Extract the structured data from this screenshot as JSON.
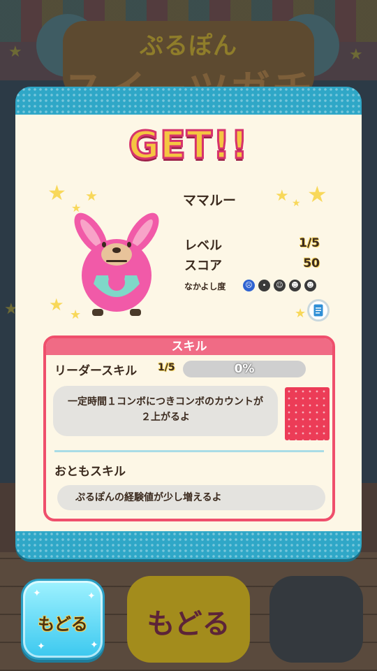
{
  "background": {
    "title_small": "ぷるぽん",
    "title_big": "スイーツガチャ",
    "back_button_label": "もどる"
  },
  "dialog": {
    "title": "GET!!",
    "character": {
      "name": "ママルー",
      "level_label": "レベル",
      "level_value": "1/5",
      "score_label": "スコア",
      "score_value": "50",
      "friendship_label": "なかよし度",
      "friendship_level": 1,
      "friendship_max": 5,
      "friendship_faces": [
        "sad-face-icon",
        "neutral-face-icon",
        "smile-face-icon",
        "grin-face-icon",
        "cool-face-icon"
      ]
    },
    "skills": {
      "header": "スキル",
      "leader": {
        "label": "リーダースキル",
        "level": "1/5",
        "progress_text": "0%",
        "progress": 0,
        "description": "一定時間１コンボにつきコンボのカウントが２上がるよ"
      },
      "buddy": {
        "label": "おともスキル",
        "description": "ぷるぽんの経験値が少し増えるよ"
      }
    }
  },
  "footer": {
    "back_button_label": "もどる"
  },
  "colors": {
    "panel_border": "#2fa7c7",
    "panel_body": "#fdf7e6",
    "skill_accent": "#ef4f6c",
    "progress_fill": "#43b6d6",
    "back_button": "#3bc8ef"
  }
}
